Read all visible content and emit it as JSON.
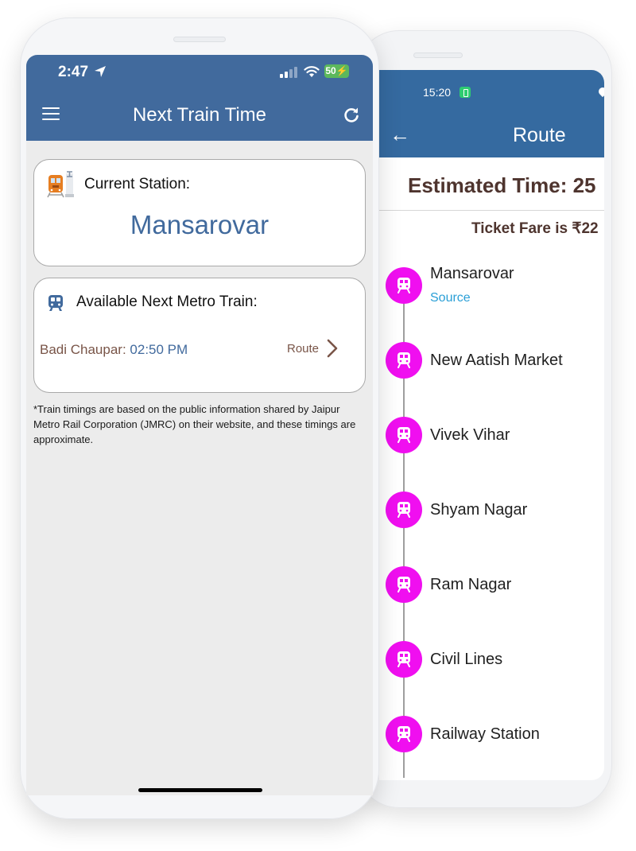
{
  "route_screen": {
    "status_bar": {
      "time": "15:20",
      "battery_icon": "battery-saver-icon",
      "location_icon": "location-pin-icon"
    },
    "app_bar": {
      "back_icon": "arrow-back-icon",
      "back_glyph": "←",
      "title": "Route"
    },
    "estimated_time": "Estimated Time: 25",
    "ticket_fare": "Ticket Fare is ₹22",
    "stops": [
      {
        "name": "Mansarovar",
        "subtitle": "Source"
      },
      {
        "name": "New Aatish Market"
      },
      {
        "name": "Vivek Vihar"
      },
      {
        "name": "Shyam Nagar"
      },
      {
        "name": "Ram Nagar"
      },
      {
        "name": "Civil Lines"
      },
      {
        "name": "Railway Station"
      }
    ],
    "colors": {
      "app_bar": "#356aa0",
      "stop_marker": "#f00ff0",
      "source_label": "#2a9fd6",
      "heading_text": "#4e342e"
    }
  },
  "next_train_screen": {
    "status_bar": {
      "time": "2:47",
      "location_icon": "location-arrow-icon",
      "signal_icon": "cellular-signal-icon",
      "wifi_icon": "wifi-icon",
      "battery": "50"
    },
    "app_bar": {
      "menu_icon": "hamburger-menu-icon",
      "title": "Next Train Time",
      "refresh_icon": "refresh-icon"
    },
    "current_station_card": {
      "icon": "train-station-icon",
      "label": "Current Station:",
      "station": "Mansarovar"
    },
    "next_metro_card": {
      "icon": "metro-train-icon",
      "label": "Available Next Metro Train:",
      "destination": "Badi Chaupar: ",
      "time": "02:50 PM",
      "route_label": "Route",
      "route_icon": "chevron-right-icon"
    },
    "disclaimer": "*Train timings are based on the public information shared by Jaipur Metro Rail Corporation (JMRC) on their website, and these timings are approximate.",
    "colors": {
      "app_bar": "#416a9d",
      "accent_text": "#416a9d",
      "destination_text": "#795548",
      "background": "#ececec"
    }
  }
}
